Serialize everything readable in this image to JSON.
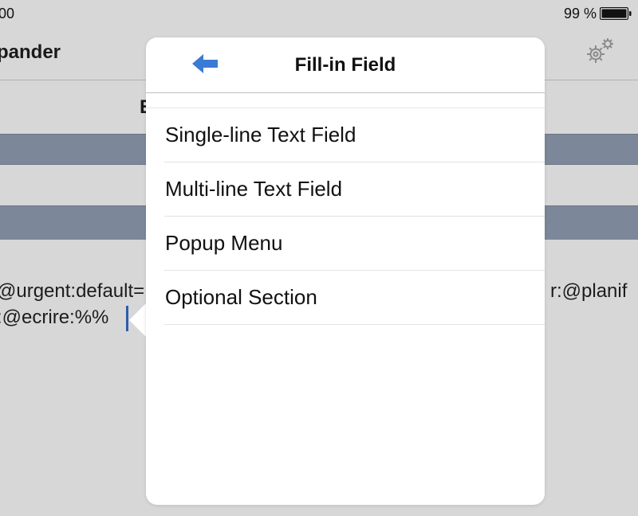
{
  "status_bar": {
    "time": "00",
    "battery_percent": "99 %"
  },
  "nav": {
    "title": "pander",
    "settings_icon": "gear-icon"
  },
  "background": {
    "segment_label": "E",
    "content_lines": [
      "@urgent:default=",
      ":@ecrire:%%",
      "r:@planif"
    ]
  },
  "popover": {
    "title": "Fill-in Field",
    "back_icon": "back-arrow-icon",
    "items": [
      {
        "label": "Single-line Text Field"
      },
      {
        "label": "Multi-line Text Field"
      },
      {
        "label": "Popup Menu"
      },
      {
        "label": "Optional Section"
      }
    ]
  },
  "colors": {
    "background": "#d7d7d7",
    "section_header": "#7c889a",
    "accent_blue": "#3a7bd5",
    "cursor": "#2e5da8"
  }
}
